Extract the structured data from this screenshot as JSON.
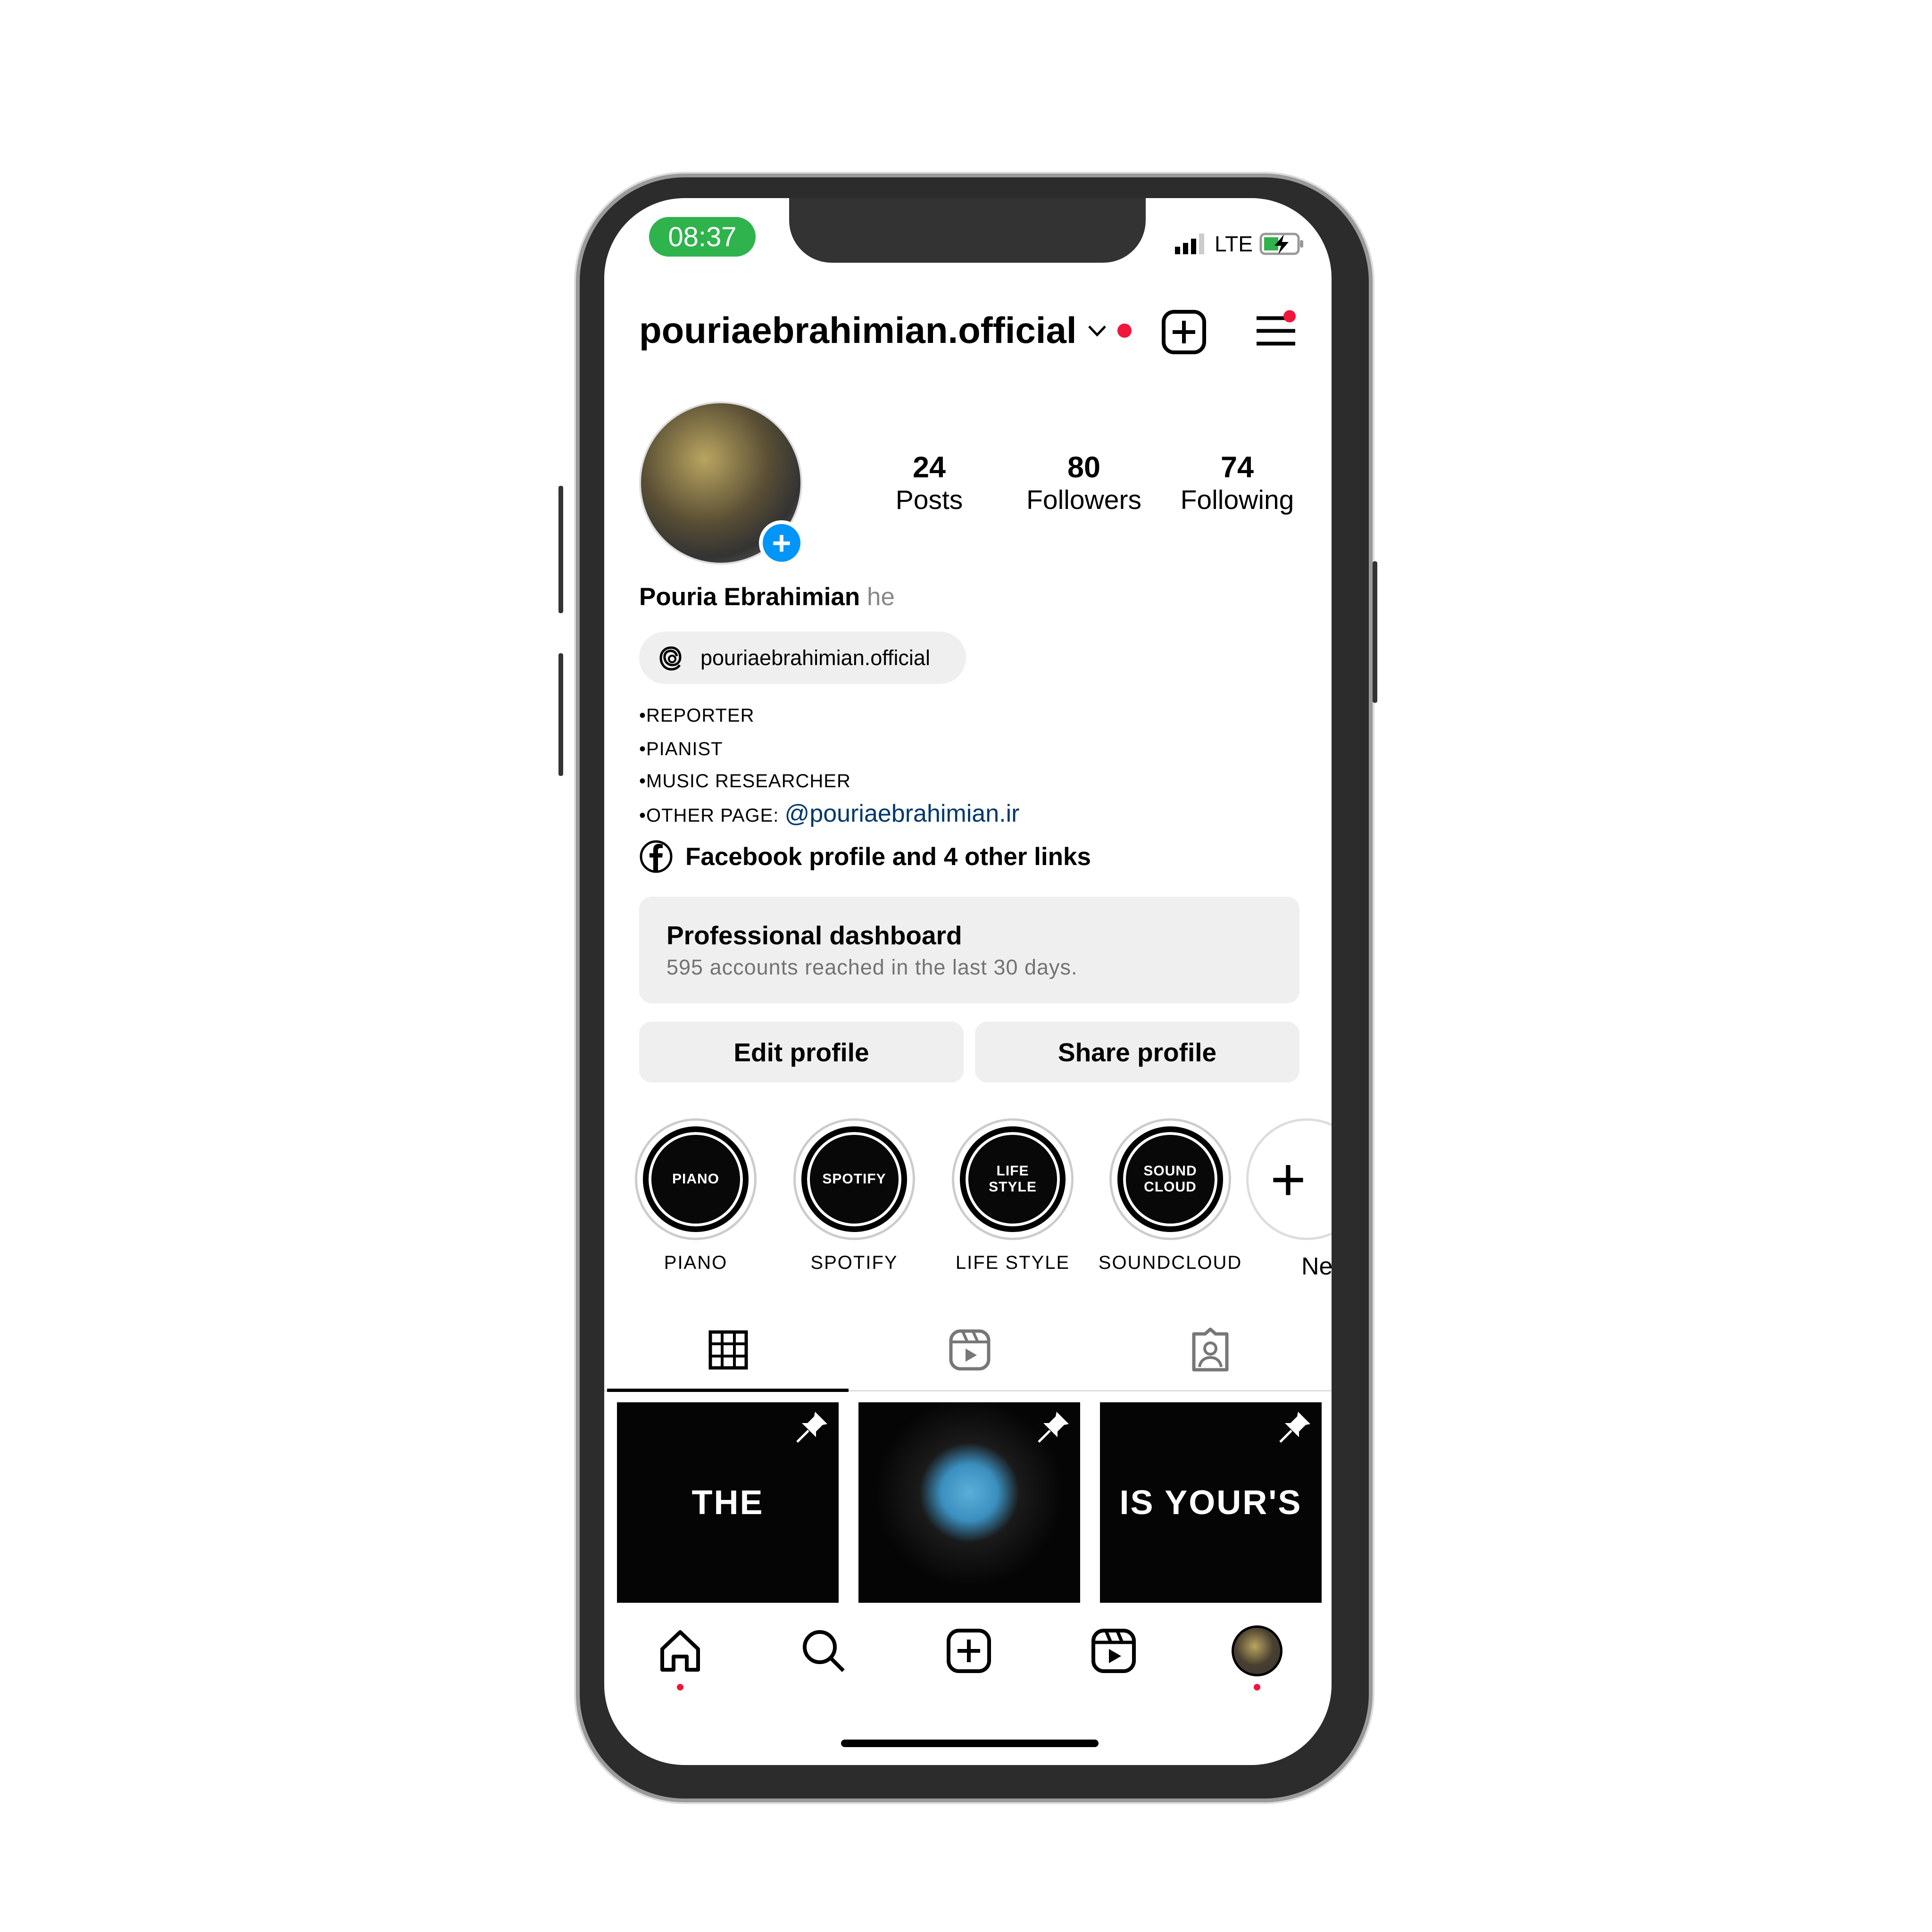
{
  "status_bar": {
    "time": "08:37",
    "network": "LTE",
    "time_pill_color": "#2fb34d"
  },
  "header": {
    "username": "pouriaebrahimian.official",
    "icons": [
      "chevron-down-icon",
      "plus-square-icon",
      "menu-icon"
    ],
    "accent_dot": "#f0163c"
  },
  "profile": {
    "stats": [
      {
        "value": "24",
        "label": "Posts"
      },
      {
        "value": "80",
        "label": "Followers"
      },
      {
        "value": "74",
        "label": "Following"
      }
    ],
    "name": "Pouria Ebrahimian",
    "pronoun": "he",
    "threads_handle": "pouriaebrahimian.official",
    "bio": [
      "•REPORTER",
      "•PIANIST",
      "•MUSIC RESEARCHER"
    ],
    "bio_other_prefix": "•OTHER PAGE: ",
    "bio_other_link": "@pouriaebrahimian.ir",
    "links_text": "Facebook profile and 4 other links"
  },
  "dashboard": {
    "title": "Professional dashboard",
    "subtitle": "595 accounts reached in the last 30 days."
  },
  "buttons": {
    "edit": "Edit profile",
    "share": "Share profile"
  },
  "highlights": [
    {
      "cover": "PIANO",
      "label": "PIANO"
    },
    {
      "cover": "SPOTIFY",
      "label": "SPOTIFY"
    },
    {
      "cover": "LIFE\nSTYLE",
      "label": "LIFE STYLE"
    },
    {
      "cover": "SOUND\nCLOUD",
      "label": "SOUNDCLOUD"
    },
    {
      "cover": "+",
      "label": "New"
    }
  ],
  "tabs": [
    "grid-icon",
    "reels-icon",
    "tagged-icon"
  ],
  "posts": [
    {
      "text": "THE",
      "pinned": true
    },
    {
      "text": "",
      "pinned": true
    },
    {
      "text": "IS YOUR'S",
      "pinned": true
    }
  ],
  "bottom_nav": [
    "home-icon",
    "search-icon",
    "create-icon",
    "reels-icon",
    "profile-avatar"
  ]
}
